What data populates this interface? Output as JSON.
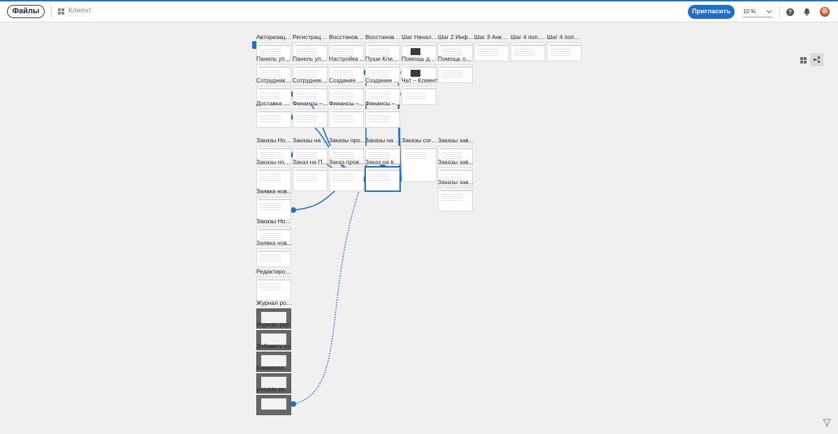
{
  "header": {
    "files_label": "Файлы",
    "project_name": "Клиент",
    "invite_label": "Пригласить",
    "zoom_value": "10 %",
    "help_glyph": "?"
  },
  "icons": {
    "project": "grid-icon",
    "help": "help-icon",
    "notifications": "bell-icon",
    "view_grid": "grid-view-icon",
    "view_flow": "flow-view-icon",
    "feedback": "feedback-icon"
  },
  "colors": {
    "accent": "#1a6fd0",
    "canvas": "#f0f0f0"
  },
  "frames": {
    "r1": [
      "Авторизаци...",
      "Регистраци...",
      "Восстановл...",
      "Восстановл...",
      "Шаг Начало...",
      "Шаг 2 Инфо ...",
      "Шаг 3 Анкет...",
      "Шаг 4 попол...",
      "Шаг 4 попол..."
    ],
    "r2": [
      "Панель упра...",
      "Панель упра...",
      "Настройка ...",
      "Пуши Клиен...",
      "Помощь док...",
      "Помощь обр..."
    ],
    "r3": [
      "Сотрудники...",
      "Сотрудники...",
      "Создание н...",
      "Создание н...",
      "Чат – Клиент"
    ],
    "r4": [
      "Доставка Вс...",
      "Финансы – ...",
      "Финансы – ...",
      "Финансы – ..."
    ],
    "r5": [
      "Заказы Нов...",
      "Заказы на п...",
      "Заказы про...",
      "Заказы на в...",
      "Заказы согл...",
      "Заказы зав..."
    ],
    "r6": [
      "Заказы новы...",
      "Заказ на Пр...",
      "Заказ прове...",
      "Заказ на вы...",
      "Заказы зав..."
    ],
    "r7": [
      "Заявка нов...",
      "Заказы зав..."
    ],
    "col": [
      "Заказы Нов...",
      "Заявка нов...",
      "Редактиров..."
    ],
    "dark": [
      "Журнал рор...",
      "Журнал рор",
      "Добавить ка",
      "Комментари...",
      "wetable pop..."
    ]
  }
}
